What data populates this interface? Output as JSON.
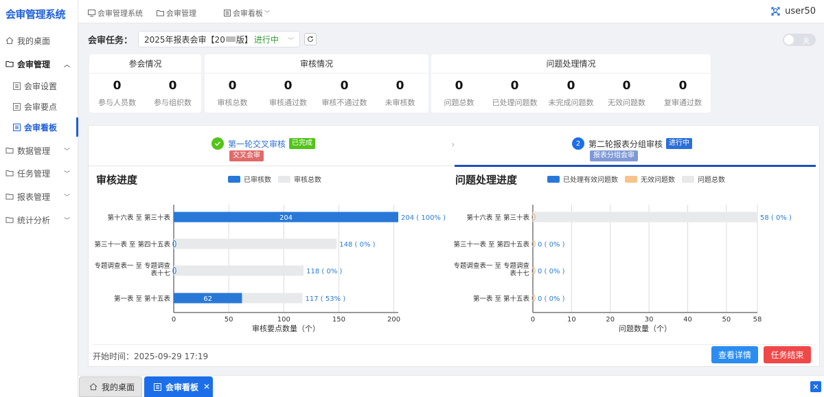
{
  "app": {
    "title": "会审管理系统",
    "user": "user50"
  },
  "sidebar": {
    "items": [
      {
        "label": "我的桌面",
        "icon": "home-icon"
      },
      {
        "label": "会审管理",
        "icon": "folder-icon"
      },
      {
        "label": "会审设置",
        "icon": "list-icon"
      },
      {
        "label": "会审要点",
        "icon": "list-icon"
      },
      {
        "label": "会审看板",
        "icon": "list-icon"
      },
      {
        "label": "数据管理",
        "icon": "folder-icon"
      },
      {
        "label": "任务管理",
        "icon": "folder-icon"
      },
      {
        "label": "报表管理",
        "icon": "folder-icon"
      },
      {
        "label": "统计分析",
        "icon": "folder-icon"
      }
    ]
  },
  "breadcrumb": [
    "会审管理系统",
    "会审管理",
    "会审看板"
  ],
  "task": {
    "label": "会审任务：",
    "selected": "2025年报表会审【20",
    "selected_suffix": "版】",
    "status": "进行中",
    "toggle_label": "关"
  },
  "stats": {
    "participation": {
      "title": "参会情况",
      "items": [
        {
          "value": "0",
          "label": "参与人员数"
        },
        {
          "value": "0",
          "label": "参与组织数"
        }
      ]
    },
    "review": {
      "title": "审核情况",
      "items": [
        {
          "value": "0",
          "label": "审核总数"
        },
        {
          "value": "0",
          "label": "审核通过数"
        },
        {
          "value": "0",
          "label": "审核不通过数"
        },
        {
          "value": "0",
          "label": "未审核数"
        }
      ]
    },
    "issues": {
      "title": "问题处理情况",
      "items": [
        {
          "value": "0",
          "label": "问题总数"
        },
        {
          "value": "0",
          "label": "已处理问题数"
        },
        {
          "value": "0",
          "label": "未完成问题数"
        },
        {
          "value": "0",
          "label": "无效问题数"
        },
        {
          "value": "0",
          "label": "复审通过数"
        }
      ]
    }
  },
  "stages": [
    {
      "name": "第一轮交叉审核",
      "status": "已完成",
      "tag": "交叉会审",
      "number": ""
    },
    {
      "name": "第二轮报表分组审核",
      "status": "进行中",
      "tag": "报表分组会审",
      "number": "2"
    }
  ],
  "colors": {
    "primary": "#2878d8",
    "done": "#52c41a",
    "invalid": "#f7c38a",
    "total": "#e8e9eb",
    "danger": "#f04848"
  },
  "chart_data": [
    {
      "type": "bar",
      "title": "审核进度",
      "orientation": "horizontal",
      "categories": [
        "第十六表 至 第三十表",
        "第三十一表 至 第四十五表",
        "专题调查表一 至 专题调查表十七",
        "第一表 至 第十五表"
      ],
      "series": [
        {
          "name": "已审核数",
          "values": [
            204,
            0,
            0,
            62
          ]
        },
        {
          "name": "审核总数",
          "values": [
            204,
            148,
            118,
            117
          ]
        }
      ],
      "data_labels": [
        "204 ( 100% )",
        "148 ( 0% )",
        "118 ( 0% )",
        "117 ( 53% )"
      ],
      "xticks": [
        "0",
        "50",
        "100",
        "150",
        "200"
      ],
      "xlim": [
        0,
        204
      ],
      "xlabel": "审核要点数量（个）",
      "ylabel": "",
      "grid": true,
      "legend": "top"
    },
    {
      "type": "bar",
      "title": "问题处理进度",
      "orientation": "horizontal",
      "categories": [
        "第十六表 至 第三十表",
        "第三十一表 至 第四十五表",
        "专题调查表一 至 专题调查表十七",
        "第一表 至 第十五表"
      ],
      "series": [
        {
          "name": "已处理有效问题数",
          "values": [
            0,
            0,
            0,
            0
          ]
        },
        {
          "name": "无效问题数",
          "values": [
            0,
            0,
            0,
            0
          ]
        },
        {
          "name": "问题总数",
          "values": [
            58,
            0,
            0,
            0
          ]
        }
      ],
      "data_labels": [
        "58 ( 0% )",
        "0 ( 0% )",
        "0 ( 0% )",
        "0 ( 0% )"
      ],
      "xticks": [
        "0",
        "10",
        "20",
        "30",
        "40",
        "50",
        "58"
      ],
      "xlim": [
        0,
        58
      ],
      "xlabel": "问题数量（个）",
      "ylabel": "",
      "grid": true,
      "legend": "top"
    }
  ],
  "footer": {
    "start_time": "开始时间：2025-09-29 17:19",
    "details_button": "查看详情",
    "finish_button": "任务结束"
  },
  "tabs": [
    {
      "label": "我的桌面"
    },
    {
      "label": "会审看板"
    }
  ]
}
